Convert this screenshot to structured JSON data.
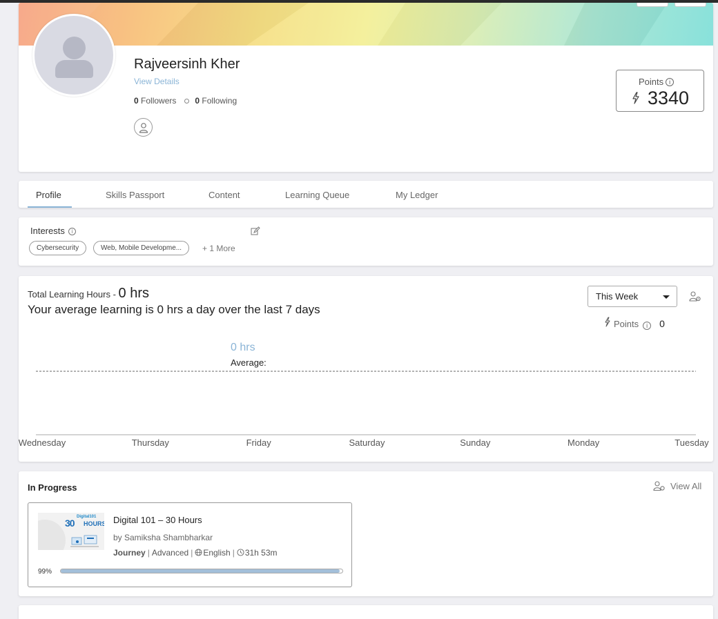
{
  "profile": {
    "name": "Rajveersinh Kher",
    "view_details": "View Details",
    "followers_count": "0",
    "followers_label": "Followers",
    "following_count": "0",
    "following_label": "Following",
    "points_label": "Points",
    "points_value": "3340"
  },
  "tabs": [
    {
      "label": "Profile",
      "active": true
    },
    {
      "label": "Skills Passport"
    },
    {
      "label": "Content"
    },
    {
      "label": "Learning Queue"
    },
    {
      "label": "My Ledger"
    }
  ],
  "interests": {
    "title": "Interests",
    "chips": [
      "Cybersecurity",
      "Web, Mobile Developme..."
    ],
    "more": "+ 1 More"
  },
  "learning": {
    "title_prefix": "Total Learning Hours -",
    "total": "0 hrs",
    "average_text": "Your average learning is 0 hrs a day over the last 7 days",
    "period": "This Week",
    "points_label": "Points",
    "points_value": "0",
    "avg_value": "0 hrs",
    "avg_label": "Average:"
  },
  "chart_data": {
    "type": "line",
    "categories": [
      "Wednesday",
      "Thursday",
      "Friday",
      "Saturday",
      "Sunday",
      "Monday",
      "Tuesday"
    ],
    "values": [
      0,
      0,
      0,
      0,
      0,
      0,
      0
    ],
    "average": 0
  },
  "in_progress": {
    "title": "In Progress",
    "view_all": "View All",
    "course": {
      "thumb_small": "Digital101",
      "thumb_num": "30",
      "thumb_word": "HOURS",
      "title": "Digital 101 – 30 Hours",
      "author": "by Samiksha Shambharkar",
      "type": "Journey",
      "level": "Advanced",
      "language": "English",
      "duration": "31h 53m",
      "progress_label": "99%",
      "progress": 0.99
    }
  },
  "colors": {
    "accent": "#8ab4d6",
    "progress_fill": "#a3bfd9"
  }
}
